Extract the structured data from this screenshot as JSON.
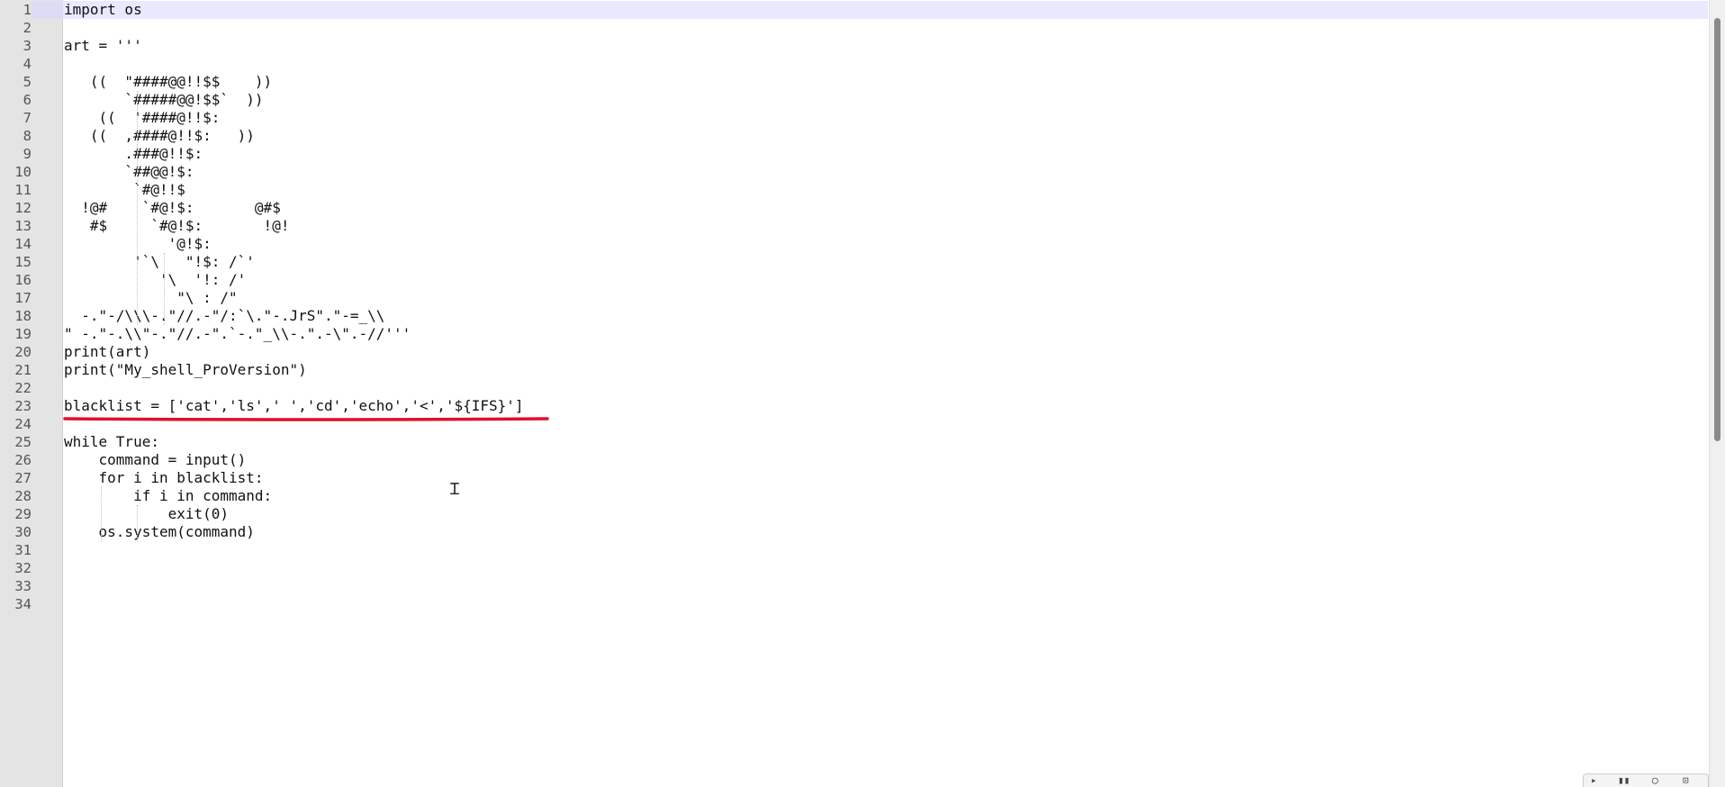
{
  "editor": {
    "current_line": 1,
    "lines": [
      "import os",
      "",
      "art = '''",
      "",
      "   ((  \"####@@!!$$    ))",
      "       `#####@@!$$`  ))",
      "    ((  '####@!!$:",
      "   ((  ,####@!!$:   ))",
      "       .###@!!$:",
      "       `##@@!$:",
      "        `#@!!$",
      "  !@#    `#@!$:       @#$",
      "   #$     `#@!$:       !@!",
      "            '@!$:",
      "        '`\\   \"!$: /`'",
      "           '\\  '!: /'",
      "             \"\\ : /\"",
      "  -.\"-/\\\\\\-.\"//.-\"/:`\\.\"-.JrS\".\"-=_\\\\",
      "\" -.\"-.\\\\\"-.\"//.-\".`-.\"_\\\\-.\".-\\\".-//'''",
      "print(art)",
      "print(\"My_shell_ProVersion\")",
      "",
      "blacklist = ['cat','ls',' ','cd','echo','<','${IFS}']",
      "",
      "while True:",
      "    command = input()",
      "    for i in blacklist:",
      "        if i in command:",
      "            exit(0)",
      "    os.system(command)",
      "",
      "",
      "",
      ""
    ],
    "line_numbers": [
      "1",
      "2",
      "3",
      "4",
      "5",
      "6",
      "7",
      "8",
      "9",
      "10",
      "11",
      "12",
      "13",
      "14",
      "15",
      "16",
      "17",
      "18",
      "19",
      "20",
      "21",
      "22",
      "23",
      "24",
      "25",
      "26",
      "27",
      "28",
      "29",
      "30",
      "31",
      "32",
      "33",
      "34"
    ]
  },
  "annotation": {
    "underline_color": "#e0102a",
    "underlined_line": 23
  },
  "toolbar": {
    "icons": [
      "play-icon",
      "pause-icon",
      "circle-icon",
      "lock-icon"
    ]
  }
}
